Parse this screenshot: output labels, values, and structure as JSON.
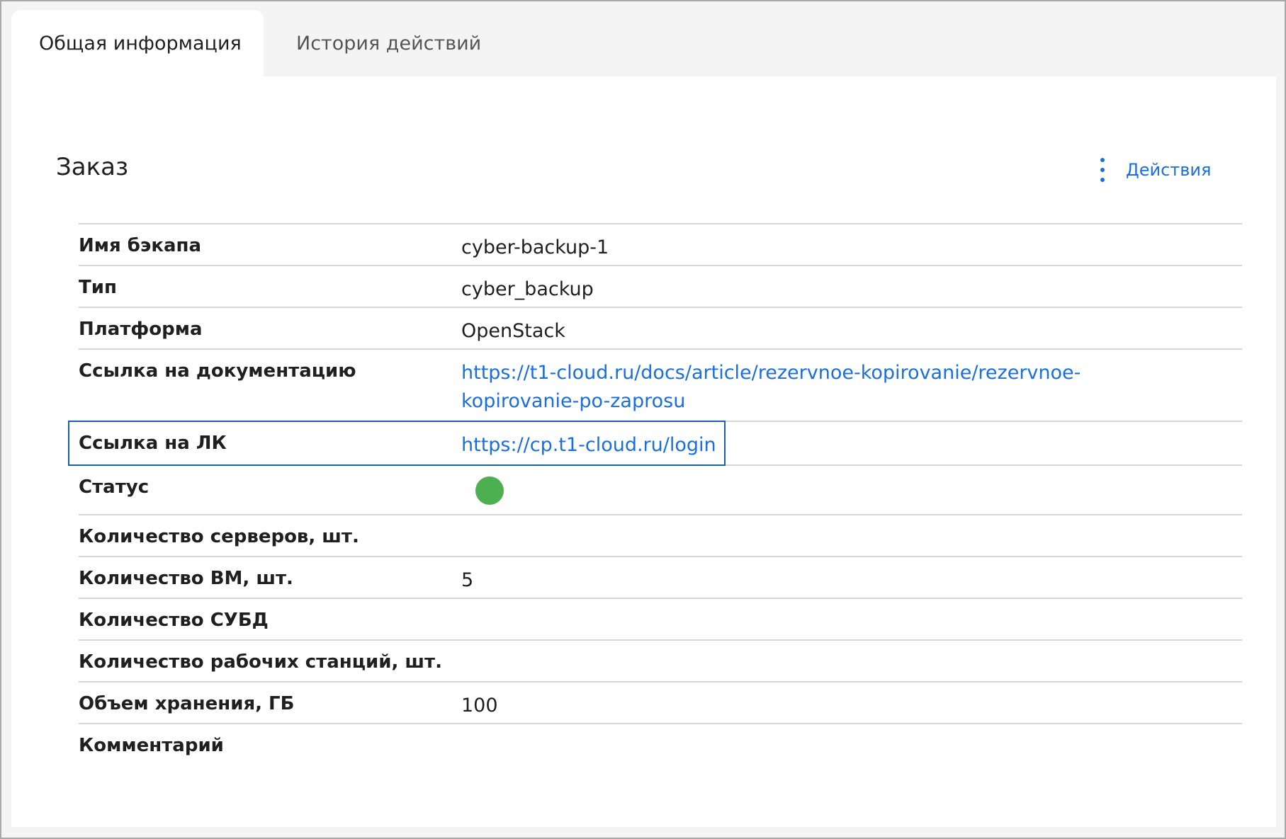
{
  "tabs": [
    {
      "label": "Общая информация",
      "active": true
    },
    {
      "label": "История действий",
      "active": false
    }
  ],
  "section": {
    "title": "Заказ",
    "actions_label": "Действия"
  },
  "rows": [
    {
      "label": "Имя бэкапа",
      "value": "cyber-backup-1"
    },
    {
      "label": "Тип",
      "value": "cyber_backup"
    },
    {
      "label": "Платформа",
      "value": "OpenStack"
    },
    {
      "label": "Ссылка на документацию",
      "value_line1": "https://t1-cloud.ru/docs/article/rezervnoe-kopirovanie/rezervnoe-",
      "value_line2": "kopirovanie-po-zaprosu"
    },
    {
      "label": "Ссылка на ЛК",
      "value": "https://cp.t1-cloud.ru/login"
    },
    {
      "label": "Статус",
      "status_color": "#4caf50"
    },
    {
      "label": "Количество серверов, шт.",
      "value": ""
    },
    {
      "label": "Количество ВМ, шт.",
      "value": "5"
    },
    {
      "label": "Количество СУБД",
      "value": ""
    },
    {
      "label": "Количество рабочих станций, шт.",
      "value": ""
    },
    {
      "label": "Объем хранения, ГБ",
      "value": "100"
    },
    {
      "label": "Комментарий",
      "value": ""
    }
  ],
  "colors": {
    "accent": "#1a6fe0",
    "highlight_border": "#1a5fa8",
    "status_ok": "#4caf50"
  }
}
